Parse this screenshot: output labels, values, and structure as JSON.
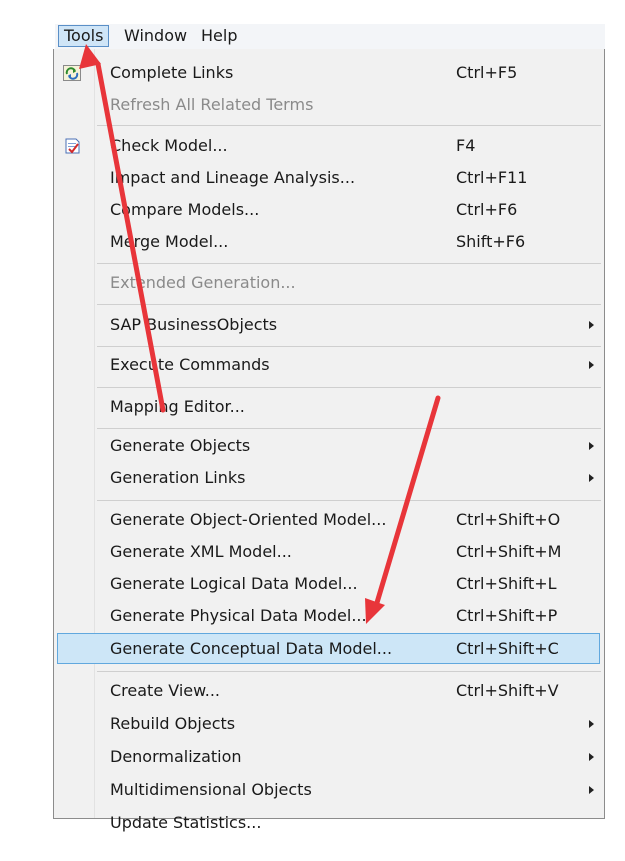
{
  "menubar": {
    "items": [
      "Tools",
      "Window",
      "Help"
    ]
  },
  "menu": {
    "items": [
      {
        "label": "Complete Links",
        "shortcut": "Ctrl+F5",
        "icon": "complete-links-icon"
      },
      {
        "label": "Refresh All Related Terms",
        "shortcut": "",
        "disabled": true
      },
      {
        "label": "Check Model...",
        "shortcut": "F4",
        "icon": "check-model-icon"
      },
      {
        "label": "Impact and Lineage Analysis...",
        "shortcut": "Ctrl+F11"
      },
      {
        "label": "Compare Models...",
        "shortcut": "Ctrl+F6"
      },
      {
        "label": "Merge Model...",
        "shortcut": "Shift+F6"
      },
      {
        "label": "Extended Generation...",
        "shortcut": "",
        "disabled": true
      },
      {
        "label": "SAP BusinessObjects",
        "shortcut": "",
        "submenu": true
      },
      {
        "label": "Execute Commands",
        "shortcut": "",
        "submenu": true
      },
      {
        "label": "Mapping Editor...",
        "shortcut": ""
      },
      {
        "label": "Generate Objects",
        "shortcut": "",
        "submenu": true
      },
      {
        "label": "Generation Links",
        "shortcut": "",
        "submenu": true
      },
      {
        "label": "Generate Object-Oriented Model...",
        "shortcut": "Ctrl+Shift+O"
      },
      {
        "label": "Generate XML Model...",
        "shortcut": "Ctrl+Shift+M"
      },
      {
        "label": "Generate Logical Data Model...",
        "shortcut": "Ctrl+Shift+L"
      },
      {
        "label": "Generate Physical Data Model...",
        "shortcut": "Ctrl+Shift+P"
      },
      {
        "label": "Generate Conceptual Data Model...",
        "shortcut": "Ctrl+Shift+C",
        "highlighted": true
      },
      {
        "label": "Create View...",
        "shortcut": "Ctrl+Shift+V"
      },
      {
        "label": "Rebuild Objects",
        "shortcut": "",
        "submenu": true
      },
      {
        "label": "Denormalization",
        "shortcut": "",
        "submenu": true
      },
      {
        "label": "Multidimensional Objects",
        "shortcut": "",
        "submenu": true
      },
      {
        "label": "Update Statistics...",
        "shortcut": ""
      }
    ]
  },
  "colors": {
    "highlight_bg": "#cde6f7",
    "highlight_border": "#61a8de",
    "annotation_arrow": "#e8353a"
  }
}
